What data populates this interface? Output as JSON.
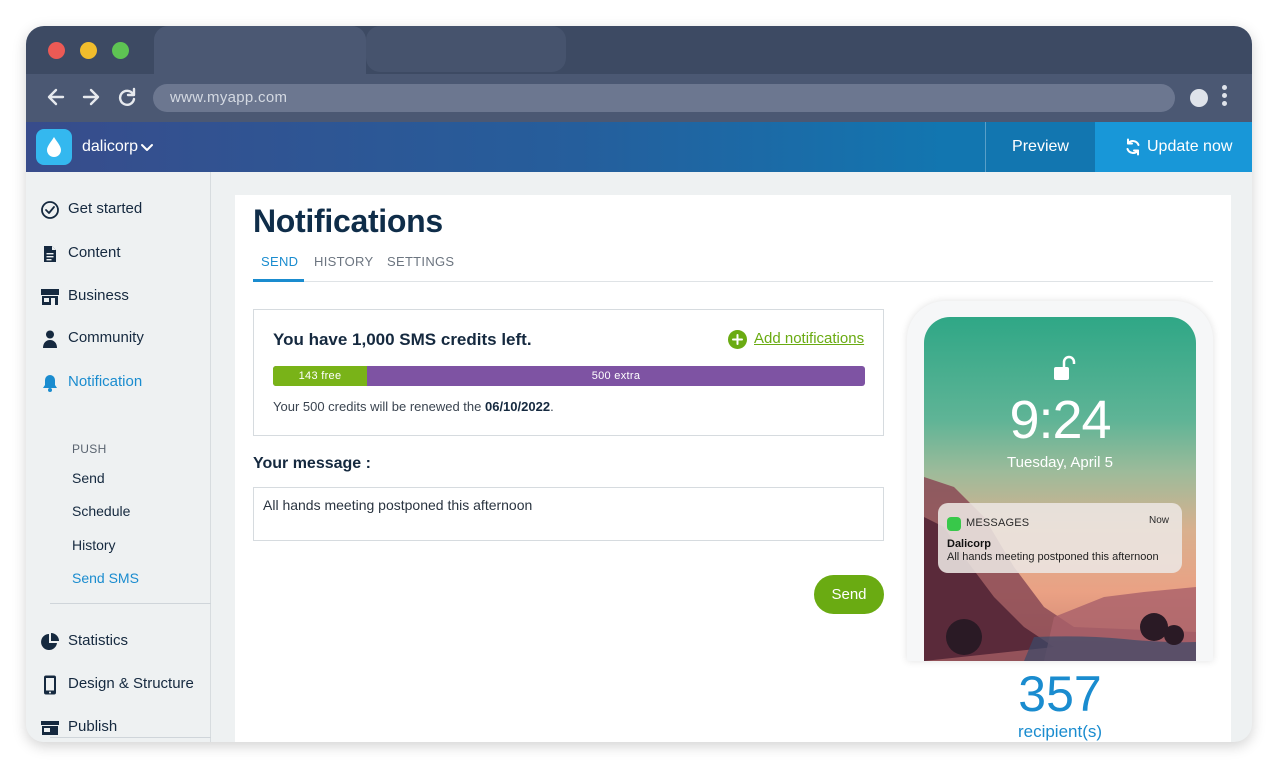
{
  "browser": {
    "url": "www.myapp.com"
  },
  "header": {
    "company": "dalicorp",
    "preview_label": "Preview",
    "update_label": "Update now"
  },
  "sidebar": {
    "items": [
      {
        "label": "Get started",
        "icon": "check-circle-icon"
      },
      {
        "label": "Content",
        "icon": "document-icon"
      },
      {
        "label": "Business",
        "icon": "store-icon"
      },
      {
        "label": "Community",
        "icon": "user-icon"
      },
      {
        "label": "Notification",
        "icon": "bell-icon"
      }
    ],
    "sub_heading": "PUSH",
    "sub_items": [
      "Send",
      "Schedule",
      "History",
      "Send SMS"
    ],
    "items_lower": [
      {
        "label": "Statistics",
        "icon": "pie-chart-icon"
      },
      {
        "label": "Design & Structure",
        "icon": "phone-icon"
      },
      {
        "label": "Publish",
        "icon": "publish-store-icon"
      }
    ]
  },
  "main": {
    "title": "Notifications",
    "tabs": [
      {
        "label": "SEND"
      },
      {
        "label": "HISTORY"
      },
      {
        "label": "SETTINGS"
      }
    ],
    "credits": {
      "title": "You have 1,000 SMS credits left.",
      "add_label": "Add notifications",
      "free_label": "143 free",
      "extra_label": "500 extra",
      "free_fraction": 0.158,
      "renew_prefix": "Your 500 credits will be renewed the ",
      "renew_date": "06/10/2022",
      "renew_suffix": "."
    },
    "message": {
      "label": "Your message :",
      "value": "All hands meeting postponed this afternoon"
    },
    "send_label": "Send",
    "preview": {
      "time": "9:24",
      "date": "Tuesday, April 5",
      "notif_app": "MESSAGES",
      "notif_time": "Now",
      "notif_sender": "Dalicorp",
      "notif_body": "All hands meeting postponed this afternoon"
    },
    "recipients": {
      "count": "357",
      "label": "recipient(s)"
    }
  },
  "colors": {
    "accent_blue": "#1a8ccf",
    "accent_green": "#6aab12",
    "extra_purple": "#7e53a3",
    "free_green": "#79b318",
    "title_navy": "#0f2d49"
  }
}
